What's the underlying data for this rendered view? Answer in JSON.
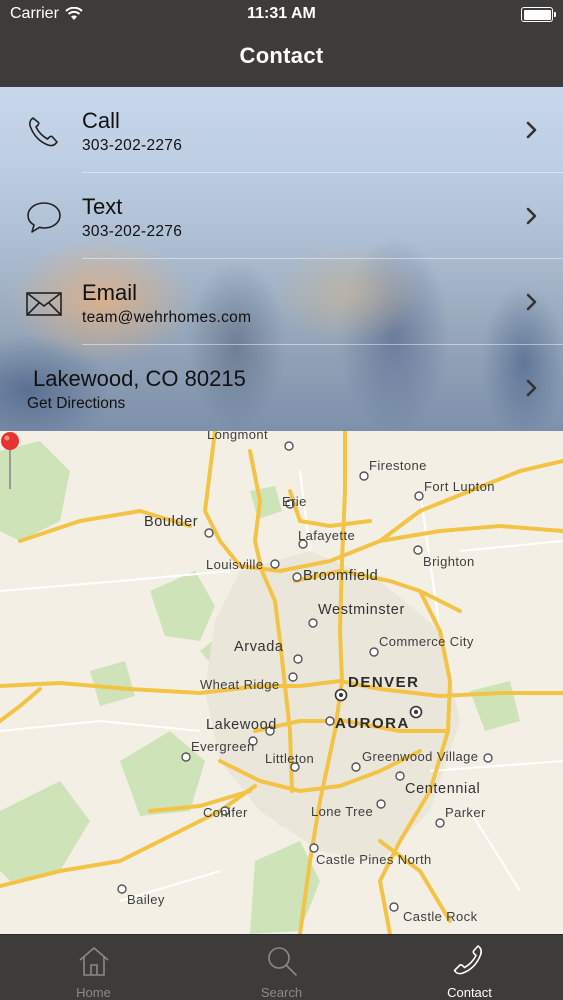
{
  "status_bar": {
    "carrier": "Carrier",
    "time": "11:31 AM"
  },
  "nav": {
    "title": "Contact"
  },
  "contact": {
    "rows": [
      {
        "label": "Call",
        "detail": "303-202-2276",
        "icon": "phone-icon"
      },
      {
        "label": "Text",
        "detail": "303-202-2276",
        "icon": "speech-bubble-icon"
      },
      {
        "label": "Email",
        "detail": "team@wehrhomes.com",
        "icon": "envelope-icon"
      }
    ],
    "address": {
      "label": "Lakewood, CO 80215",
      "action": "Get Directions"
    }
  },
  "map": {
    "places": [
      {
        "name": "Longmont"
      },
      {
        "name": "Firestone"
      },
      {
        "name": "Fort Lupton"
      },
      {
        "name": "Boulder"
      },
      {
        "name": "Erie"
      },
      {
        "name": "Lafayette"
      },
      {
        "name": "Louisville"
      },
      {
        "name": "Broomfield"
      },
      {
        "name": "Brighton"
      },
      {
        "name": "Westminster"
      },
      {
        "name": "Commerce City"
      },
      {
        "name": "Arvada"
      },
      {
        "name": "Wheat Ridge"
      },
      {
        "name": "DENVER"
      },
      {
        "name": "Lakewood"
      },
      {
        "name": "AURORA"
      },
      {
        "name": "Evergreen"
      },
      {
        "name": "Littleton"
      },
      {
        "name": "Greenwood Village"
      },
      {
        "name": "Centennial"
      },
      {
        "name": "Conifer"
      },
      {
        "name": "Lone Tree"
      },
      {
        "name": "Parker"
      },
      {
        "name": "Castle Pines North"
      },
      {
        "name": "Bailey"
      },
      {
        "name": "Castle Rock"
      }
    ],
    "colors": {
      "land": "#f3efe4",
      "park": "#c8e0b0",
      "highway": "#f6c64a",
      "urban": "#ebe6dc",
      "pin": "#e8322f"
    }
  },
  "tabs": [
    {
      "label": "Home",
      "icon": "home-icon",
      "active": false
    },
    {
      "label": "Search",
      "icon": "search-icon",
      "active": false
    },
    {
      "label": "Contact",
      "icon": "phone-icon",
      "active": true
    }
  ]
}
